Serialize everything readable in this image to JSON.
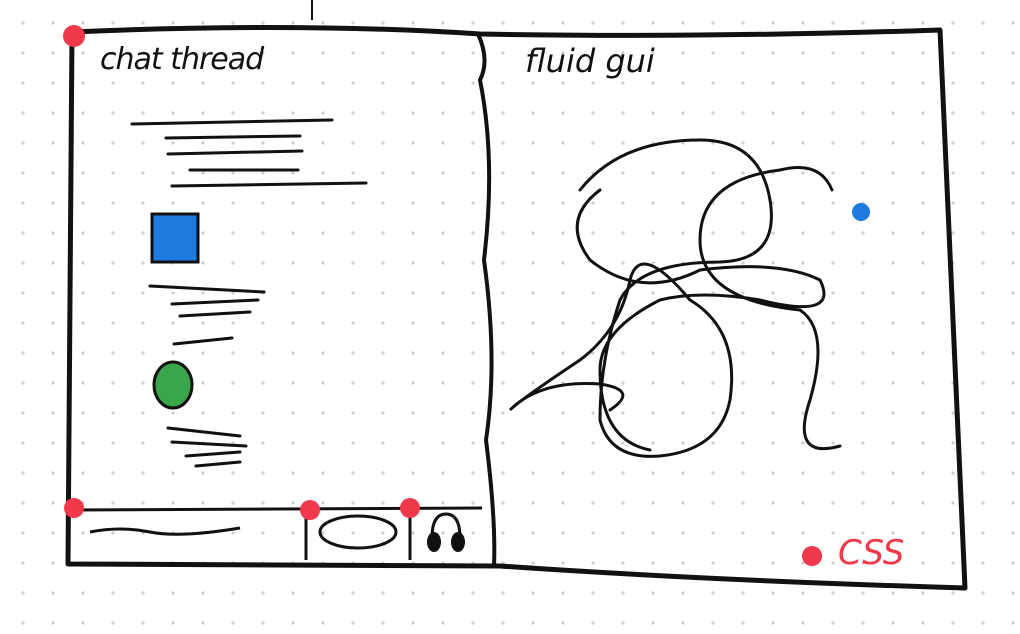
{
  "left_panel": {
    "title": "chat thread"
  },
  "right_panel": {
    "title": "fluid gui"
  },
  "legend": {
    "label": "CSS",
    "color": "#f0394a"
  },
  "colors": {
    "ink": "#111111",
    "image_fill": "#1f7ae0",
    "avatar_fill": "#3aa64a",
    "marker": "#f0394a",
    "fluid_dot": "#1f7ae0"
  }
}
